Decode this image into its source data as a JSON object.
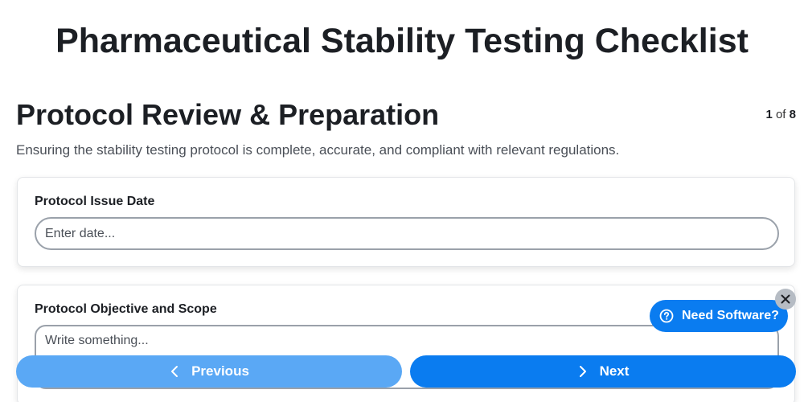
{
  "page": {
    "title": "Pharmaceutical Stability Testing Checklist"
  },
  "section": {
    "title": "Protocol Review & Preparation",
    "description": "Ensuring the stability testing protocol is complete, accurate, and compliant with relevant regulations.",
    "pager": {
      "current": "1",
      "separator": "of",
      "total": "8"
    }
  },
  "fields": {
    "issue_date": {
      "label": "Protocol Issue Date",
      "placeholder": "Enter date...",
      "value": ""
    },
    "objective_scope": {
      "label": "Protocol Objective and Scope",
      "placeholder": "Write something...",
      "value": ""
    }
  },
  "navigation": {
    "previous_label": "Previous",
    "next_label": "Next",
    "previous_icon": "chevron-left-icon",
    "next_icon": "chevron-right-icon"
  },
  "help_widget": {
    "label": "Need Software?",
    "icon": "question-circle-icon",
    "close_icon": "close-icon"
  },
  "colors": {
    "primary": "#0a7cf0",
    "primary_light": "#5aa8f5",
    "close_bg": "#b6bcc4"
  }
}
